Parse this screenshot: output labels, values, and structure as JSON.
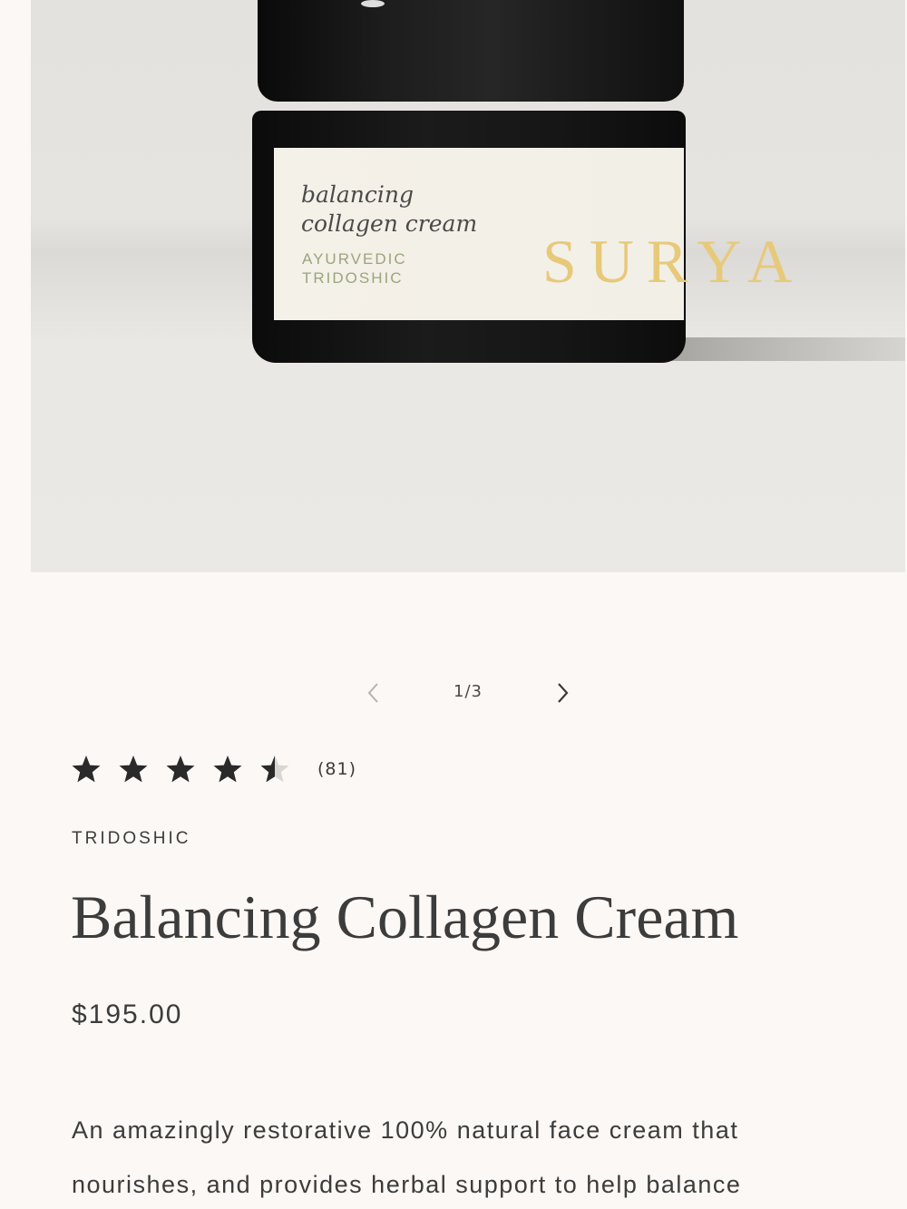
{
  "gallery": {
    "image": {
      "product_line_1": "balancing",
      "product_line_2": "collagen cream",
      "label_sub_1": "AYURVEDIC",
      "label_sub_2": "TRIDOSHIC",
      "brand_mark": "SURYA"
    },
    "counter": "1/3",
    "prev_icon": "chevron-left-icon",
    "next_icon": "chevron-right-icon"
  },
  "rating": {
    "value": 4.5,
    "max": 5,
    "count_label": "(81)",
    "star_color": "#2a2a2a",
    "star_empty_color": "#d9d6d3"
  },
  "product": {
    "vendor": "TRIDOSHIC",
    "title": "Balancing Collagen Cream",
    "price": "$195.00",
    "description": "An amazingly restorative 100% natural face cream that nourishes, and provides herbal support to help balance"
  },
  "colors": {
    "background": "#fcf8f5",
    "text": "#3c3c3c",
    "label_accent": "#9aa57c",
    "brand_gold": "#e7c97a"
  }
}
